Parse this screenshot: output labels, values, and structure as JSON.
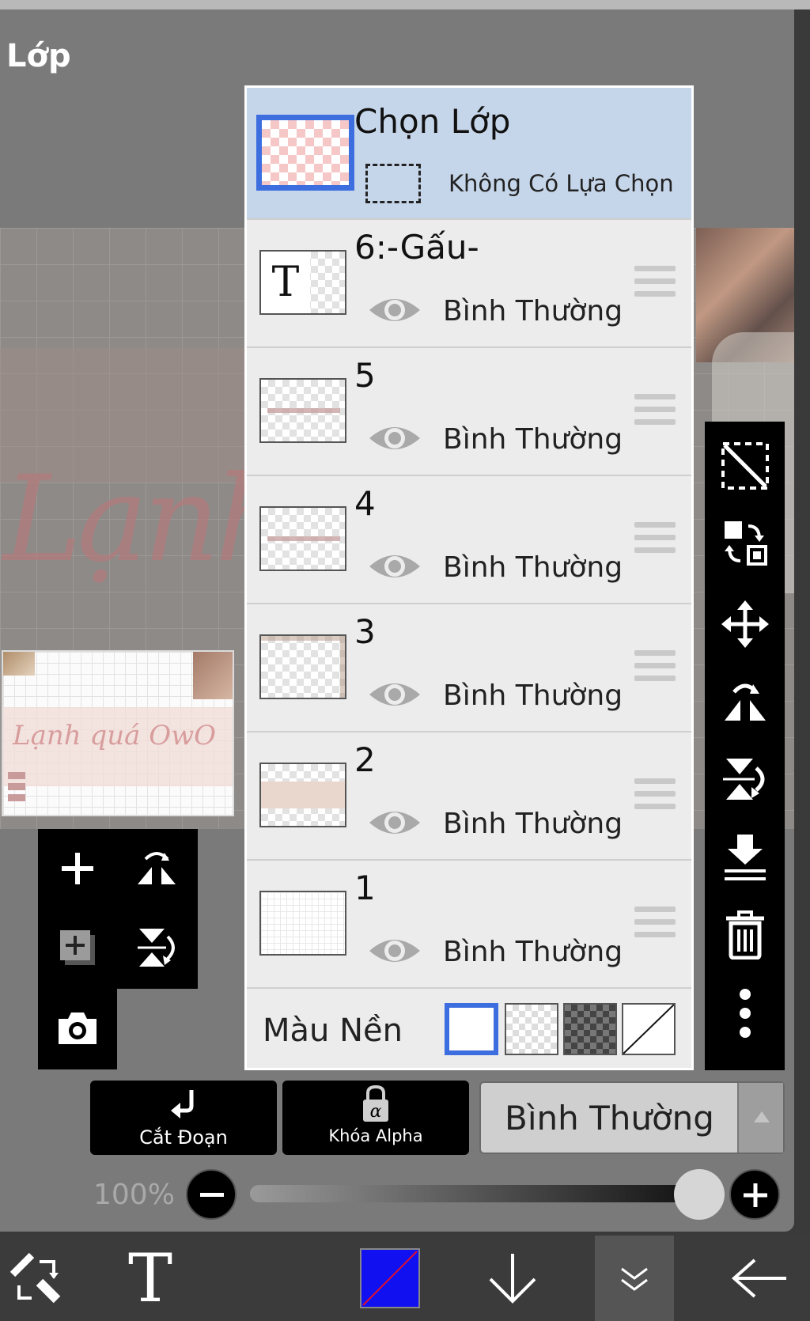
{
  "header": {
    "title": "Lớp"
  },
  "canvas": {
    "script_text": "Lạnh",
    "preview_text": "Lạnh quá OwO"
  },
  "select_layer": {
    "title": "Chọn Lớp",
    "status": "Không Có Lựa Chọn"
  },
  "layers": [
    {
      "name": "6:-Gấu-",
      "blend": "Bình Thường",
      "thumb": "text",
      "thumb_glyph": "T"
    },
    {
      "name": "5",
      "blend": "Bình Thường",
      "thumb": "text-strip"
    },
    {
      "name": "4",
      "blend": "Bình Thường",
      "thumb": "text-strip"
    },
    {
      "name": "3",
      "blend": "Bình Thường",
      "thumb": "corners"
    },
    {
      "name": "2",
      "blend": "Bình Thường",
      "thumb": "band"
    },
    {
      "name": "1",
      "blend": "Bình Thường",
      "thumb": "grid"
    }
  ],
  "background": {
    "label": "Màu Nền",
    "swatches": [
      "white",
      "checker-light",
      "checker-dark",
      "none"
    ],
    "selected": "white"
  },
  "left_tools": [
    "add-layer-icon",
    "flip-horizontal-icon",
    "add-copy-layer-icon",
    "flip-vertical-icon",
    "camera-icon"
  ],
  "right_tools": [
    "selection-clear-icon",
    "swap-layer-icon",
    "move-icon",
    "flip-horizontal-icon",
    "flip-vertical-icon",
    "merge-down-icon",
    "trash-icon",
    "more-icon"
  ],
  "controls": {
    "clipping_label": "Cắt Đoạn",
    "alpha_lock_label": "Khóa Alpha",
    "blend_mode": "Bình Thường"
  },
  "opacity": {
    "label": "100%",
    "value": 100
  },
  "bottom_bar": {
    "items": [
      "transform-icon",
      "text-tool-icon",
      "color-swatch",
      "down-arrow-icon",
      "collapse-icon",
      "back-arrow-icon"
    ],
    "text_glyph": "T",
    "color": "#1010f0"
  },
  "colors": {
    "accent": "#3d6ee0",
    "selected_row": "#c6d6ea",
    "toolbar": "#000000"
  }
}
